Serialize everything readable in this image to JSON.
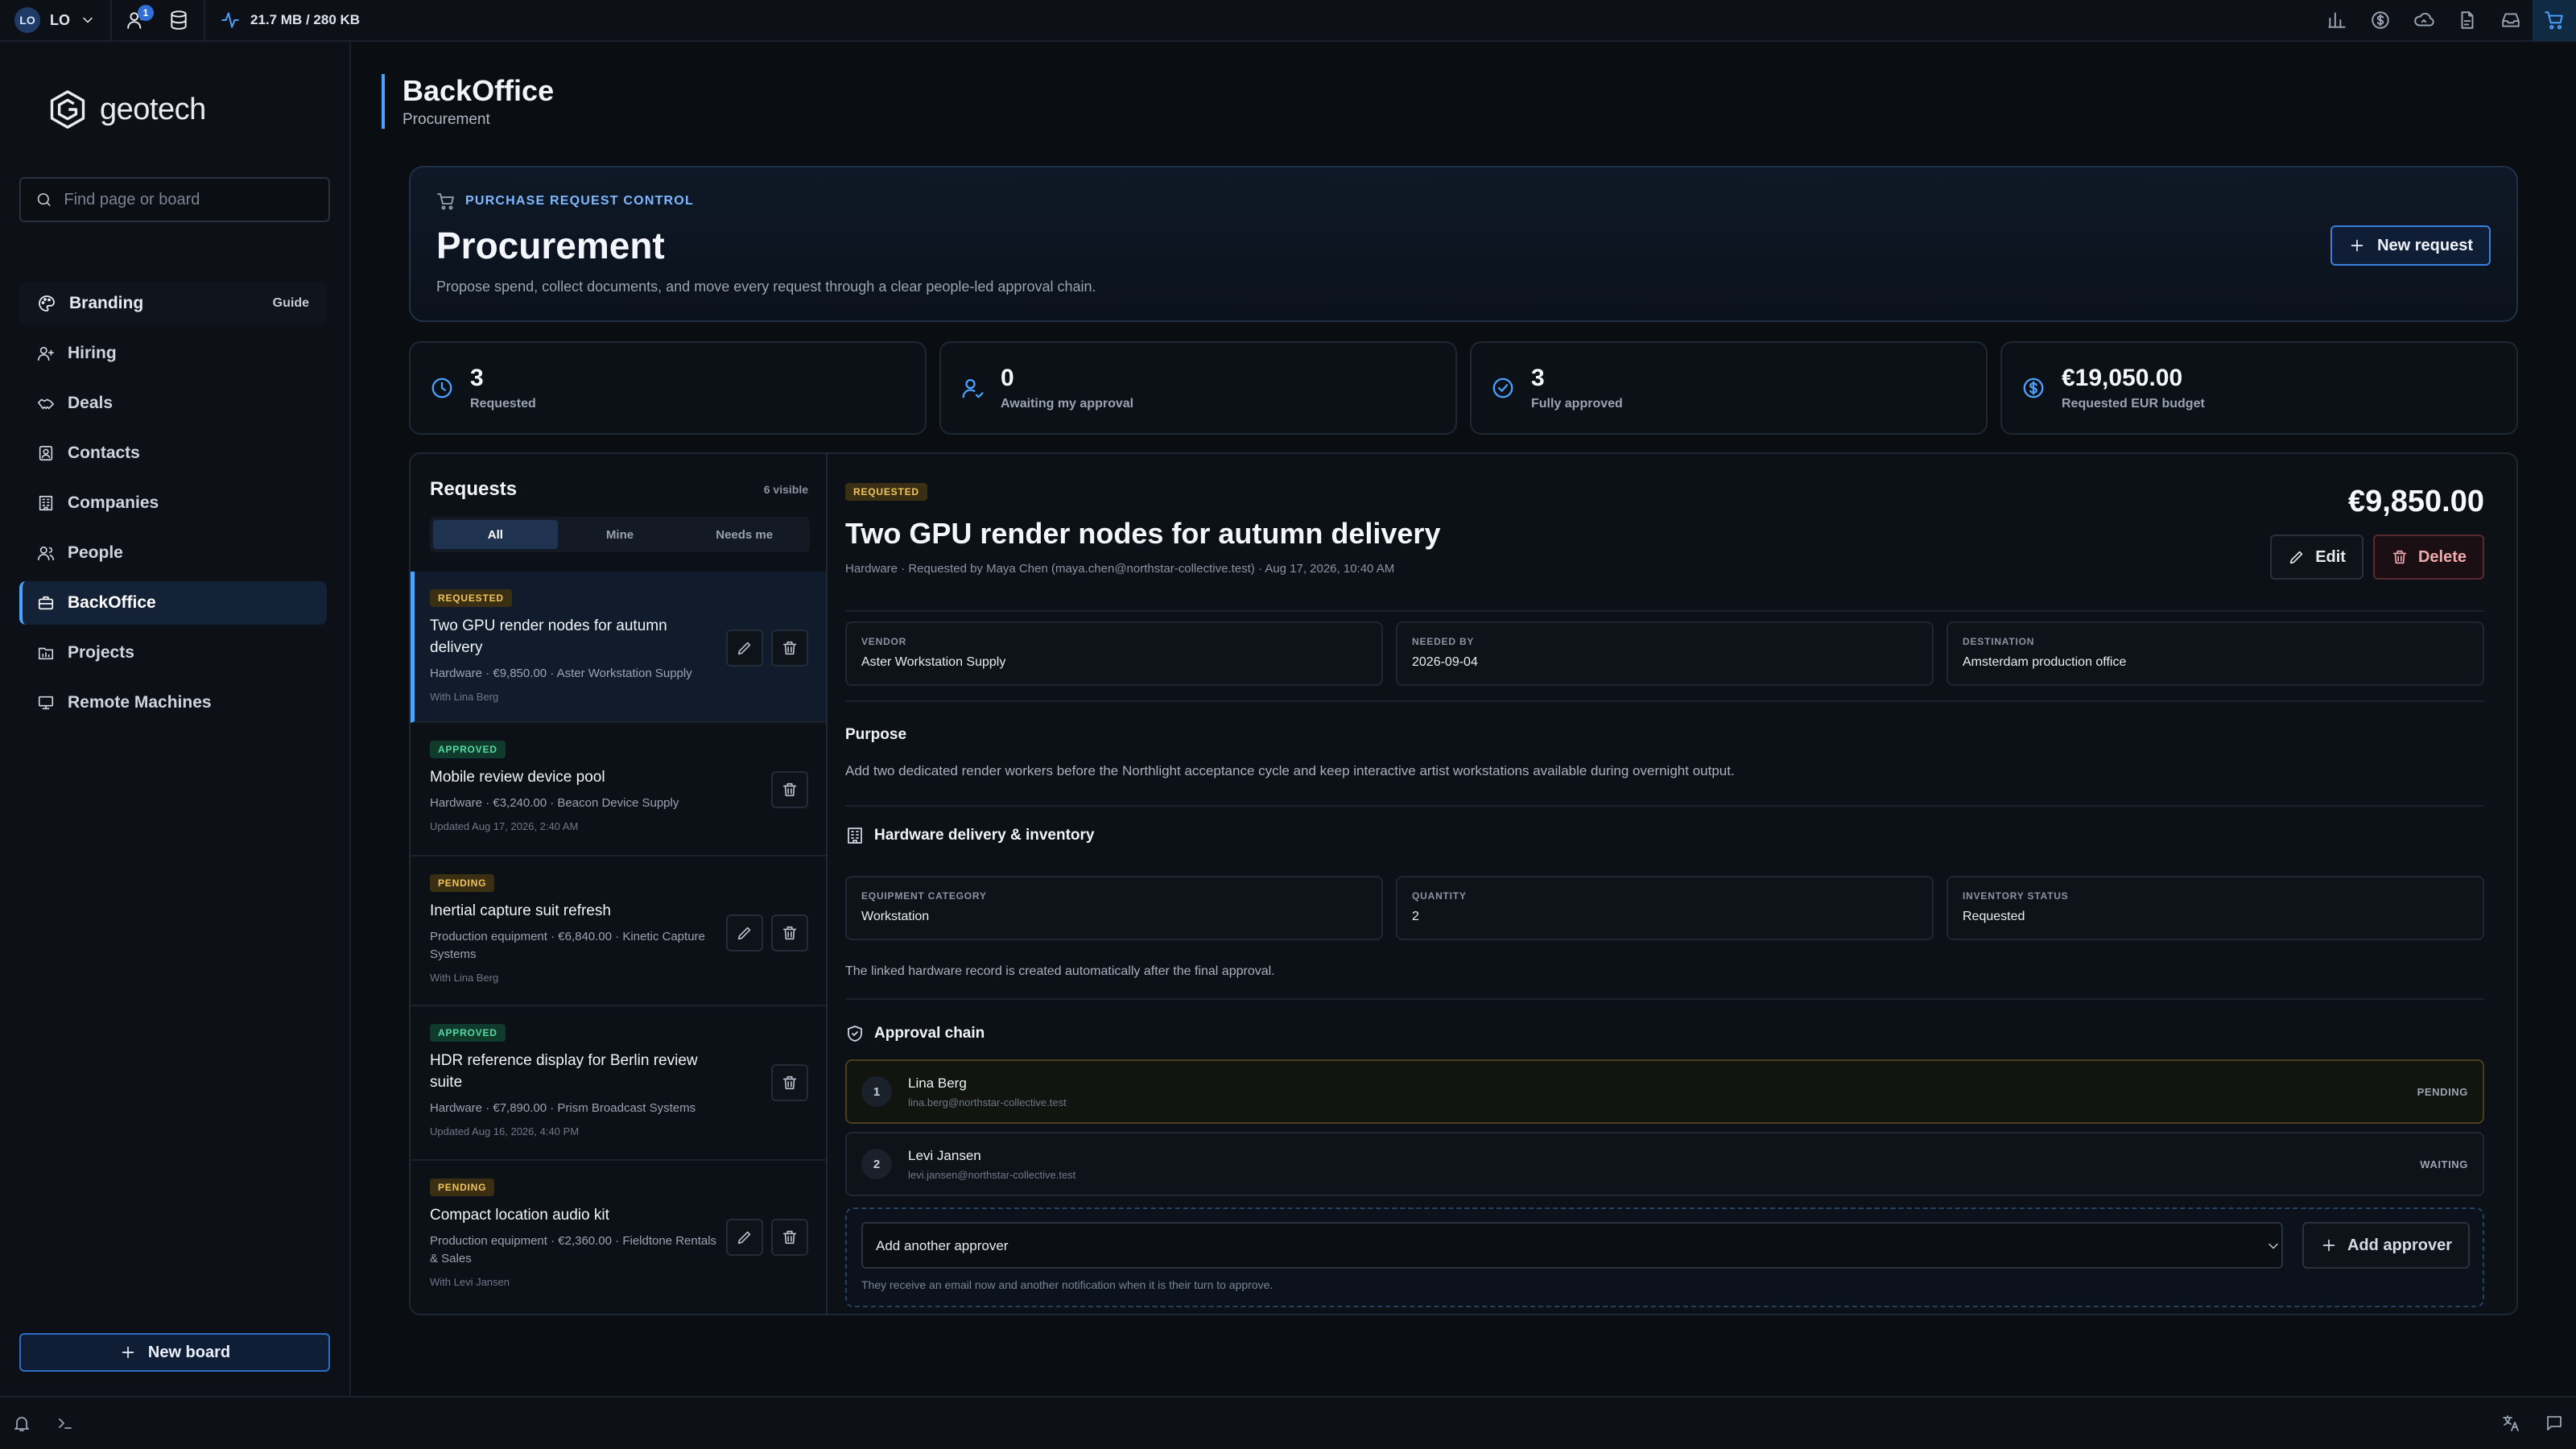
{
  "topbar": {
    "user_initials": "LO",
    "user_label": "LO",
    "notification_count": "1",
    "memory": "21.7 MB / 280 KB"
  },
  "sidebar": {
    "logo_text": "geotech",
    "search_placeholder": "Find page or board",
    "branding": {
      "label": "Branding",
      "guide": "Guide"
    },
    "items": [
      {
        "label": "Hiring"
      },
      {
        "label": "Deals"
      },
      {
        "label": "Contacts"
      },
      {
        "label": "Companies"
      },
      {
        "label": "People"
      },
      {
        "label": "BackOffice"
      },
      {
        "label": "Projects"
      },
      {
        "label": "Remote Machines"
      }
    ],
    "new_board": "New board"
  },
  "page": {
    "title": "BackOffice",
    "subtitle": "Procurement"
  },
  "hero": {
    "eyebrow": "PURCHASE REQUEST CONTROL",
    "title": "Procurement",
    "description": "Propose spend, collect documents, and move every request through a clear people-led approval chain.",
    "new_request": "New request"
  },
  "stats": [
    {
      "value": "3",
      "label": "Requested"
    },
    {
      "value": "0",
      "label": "Awaiting my approval"
    },
    {
      "value": "3",
      "label": "Fully approved"
    },
    {
      "value": "€19,050.00",
      "label": "Requested EUR budget"
    }
  ],
  "requests": {
    "title": "Requests",
    "count": "6 visible",
    "tabs": [
      "All",
      "Mine",
      "Needs me"
    ],
    "items": [
      {
        "status": "REQUESTED",
        "title": "Two GPU render nodes for autumn delivery",
        "meta": "Hardware · €9,850.00 · Aster Workstation Supply",
        "foot": "With Lina Berg"
      },
      {
        "status": "APPROVED",
        "title": "Mobile review device pool",
        "meta": "Hardware · €3,240.00 · Beacon Device Supply",
        "foot": "Updated Aug 17, 2026, 2:40 AM"
      },
      {
        "status": "PENDING",
        "title": "Inertial capture suit refresh",
        "meta": "Production equipment · €6,840.00 · Kinetic Capture Systems",
        "foot": "With Lina Berg"
      },
      {
        "status": "APPROVED",
        "title": "HDR reference display for Berlin review suite",
        "meta": "Hardware · €7,890.00 · Prism Broadcast Systems",
        "foot": "Updated Aug 16, 2026, 4:40 PM"
      },
      {
        "status": "PENDING",
        "title": "Compact location audio kit",
        "meta": "Production equipment · €2,360.00 · Fieldtone Rentals & Sales",
        "foot": "With Levi Jansen"
      }
    ]
  },
  "detail": {
    "status": "REQUESTED",
    "amount": "€9,850.00",
    "title": "Two GPU render nodes for autumn delivery",
    "subtitle": "Hardware · Requested by Maya Chen (maya.chen@northstar-collective.test) · Aug 17, 2026, 10:40 AM",
    "edit": "Edit",
    "delete": "Delete",
    "fields": [
      {
        "label": "VENDOR",
        "value": "Aster Workstation Supply"
      },
      {
        "label": "NEEDED BY",
        "value": "2026-09-04"
      },
      {
        "label": "DESTINATION",
        "value": "Amsterdam production office"
      }
    ],
    "purpose_title": "Purpose",
    "purpose_text": "Add two dedicated render workers before the Northlight acceptance cycle and keep interactive artist workstations available during overnight output.",
    "hardware_title": "Hardware delivery & inventory",
    "hardware_fields": [
      {
        "label": "EQUIPMENT CATEGORY",
        "value": "Workstation"
      },
      {
        "label": "QUANTITY",
        "value": "2"
      },
      {
        "label": "INVENTORY STATUS",
        "value": "Requested"
      }
    ],
    "hardware_note": "The linked hardware record is created automatically after the final approval.",
    "chain_title": "Approval chain",
    "approvers": [
      {
        "step": "1",
        "name": "Lina Berg",
        "email": "lina.berg@northstar-collective.test",
        "status": "PENDING"
      },
      {
        "step": "2",
        "name": "Levi Jansen",
        "email": "levi.jansen@northstar-collective.test",
        "status": "WAITING"
      }
    ],
    "add_select": "Add another approver",
    "add_button": "Add approver",
    "add_hint": "They receive an email now and another notification when it is their turn to approve."
  },
  "colors": {
    "accent": "#4aa3ff",
    "background": "#0a0d12",
    "requested": "#f2c45a",
    "approved": "#52d9a4"
  }
}
